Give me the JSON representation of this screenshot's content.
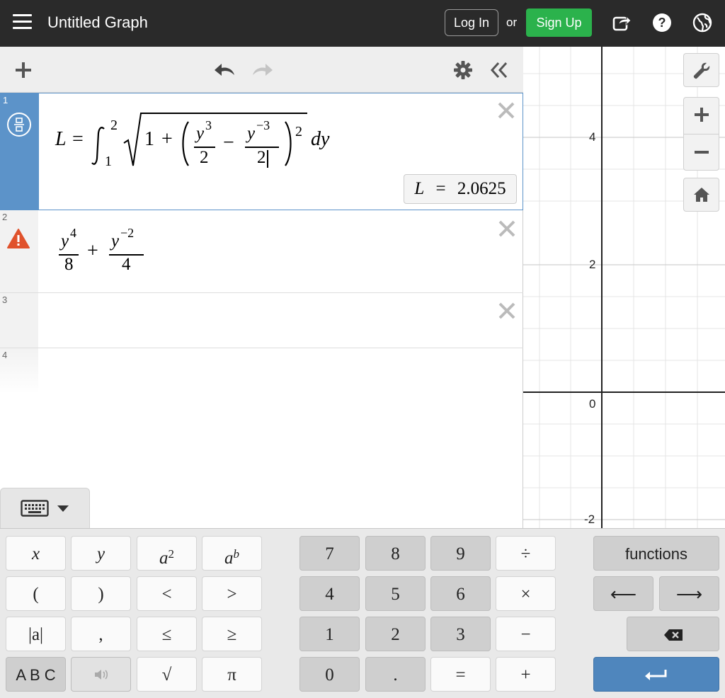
{
  "header": {
    "app_title": "Untitled Graph",
    "login_label": "Log In",
    "or_label": "or",
    "signup_label": "Sign Up",
    "colors": {
      "bar": "#2a2a2a",
      "signup": "#2bb24c"
    }
  },
  "expressions": [
    {
      "num": "1",
      "active": true,
      "icon": "fraction-toggle-icon",
      "math": {
        "lhs": "L",
        "eq": "=",
        "upper": "2",
        "lower": "1",
        "one": "1",
        "plus": "+",
        "t1_num_var": "y",
        "t1_num_exp": "3",
        "t1_den": "2",
        "minus": "−",
        "t2_num_var": "y",
        "t2_num_exp": "−3",
        "t2_den": "2",
        "sq": "2",
        "dy": "dy"
      },
      "result": {
        "var": "L",
        "eq": "=",
        "value": "2.0625"
      }
    },
    {
      "num": "2",
      "active": false,
      "icon": "warning-icon",
      "math": {
        "a_num_var": "y",
        "a_num_exp": "4",
        "a_den": "8",
        "plus": "+",
        "b_num_var": "y",
        "b_num_exp": "−2",
        "b_den": "4"
      }
    },
    {
      "num": "3",
      "active": false
    },
    {
      "num": "4",
      "active": false
    }
  ],
  "graph": {
    "y_ticks": [
      "4",
      "2",
      "0",
      "-2"
    ]
  },
  "keypad": {
    "left": [
      [
        "x",
        "y",
        "a2",
        "ab"
      ],
      [
        "(",
        ")",
        "<",
        ">"
      ],
      [
        "|a|",
        ",",
        "≤",
        "≥"
      ],
      [
        "A B C",
        "",
        "√",
        "π"
      ]
    ],
    "power_a": {
      "base": "a",
      "exp": "2"
    },
    "power_b": {
      "base": "a",
      "exp": "b"
    },
    "numbers": [
      [
        "7",
        "8",
        "9",
        "÷"
      ],
      [
        "4",
        "5",
        "6",
        "×"
      ],
      [
        "1",
        "2",
        "3",
        "−"
      ],
      [
        "0",
        ".",
        "=",
        "+"
      ]
    ],
    "functions_label": "functions",
    "left_arrow": "⟵",
    "right_arrow": "⟶"
  }
}
